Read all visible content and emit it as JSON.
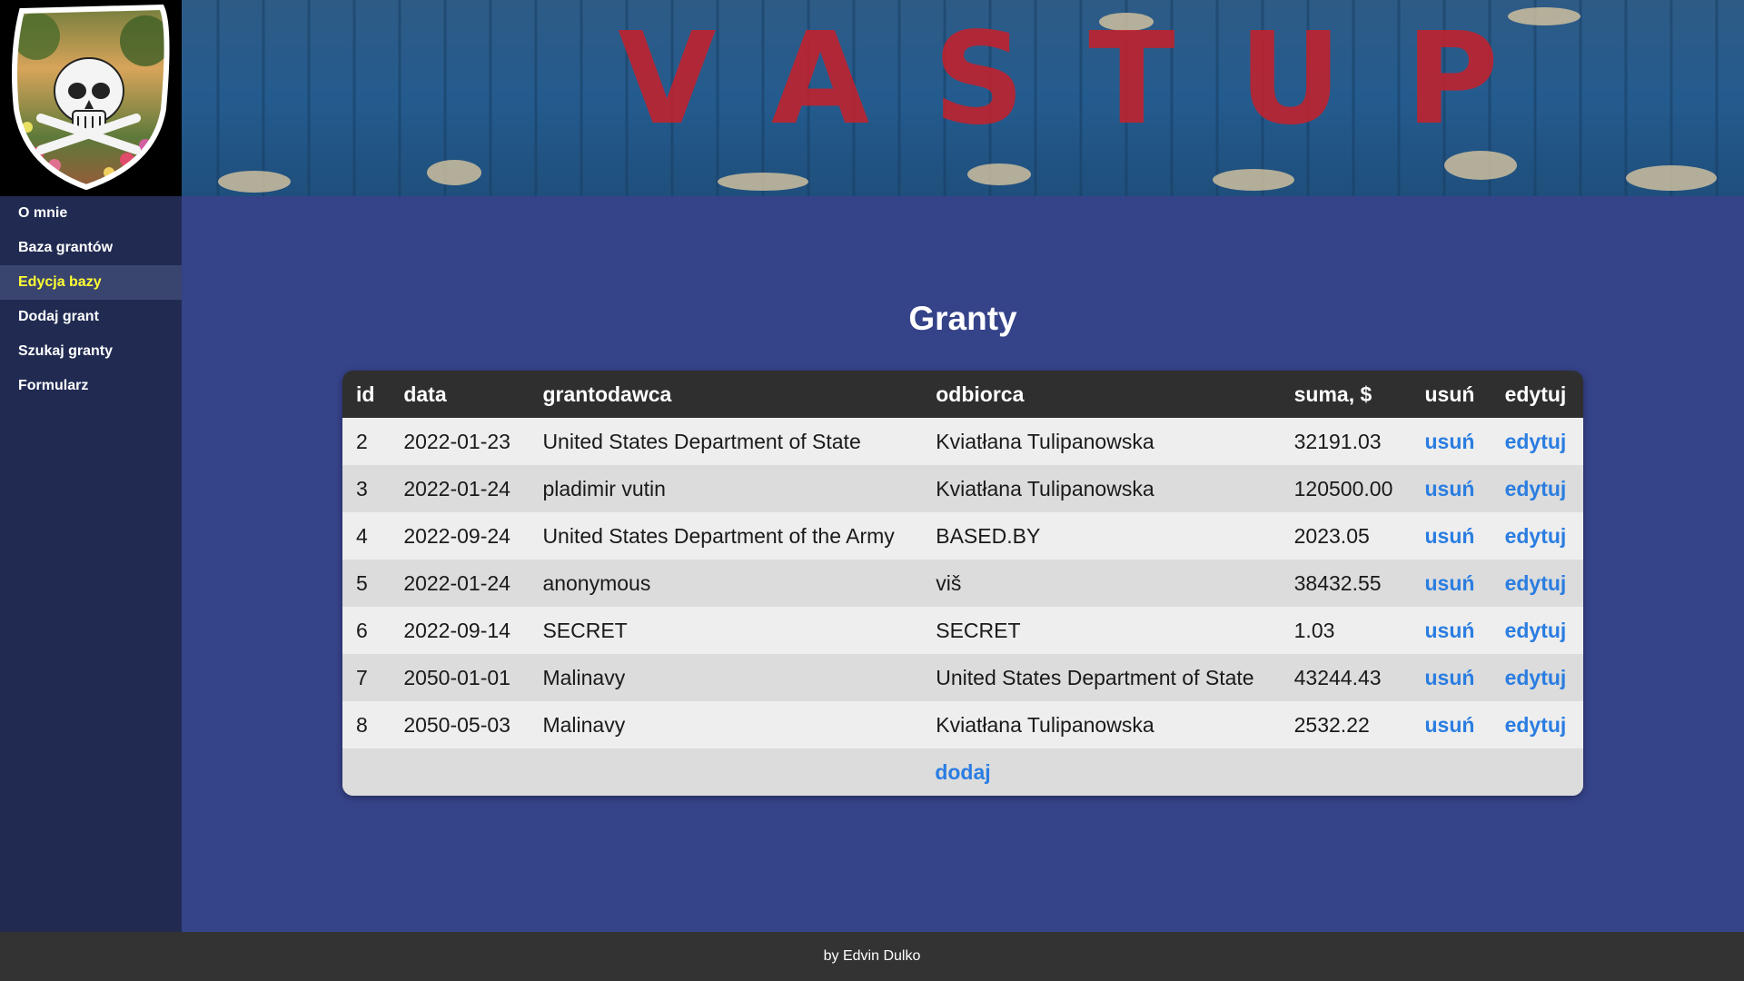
{
  "nav": {
    "items": [
      {
        "label": "O mnie"
      },
      {
        "label": "Baza grantów"
      },
      {
        "label": "Edycja bazy"
      },
      {
        "label": "Dodaj grant"
      },
      {
        "label": "Szukaj granty"
      },
      {
        "label": "Formularz"
      }
    ],
    "active_index": 2
  },
  "banner": {
    "graffiti_text": "VASTUP"
  },
  "main": {
    "title": "Granty",
    "table": {
      "headers": [
        "id",
        "data",
        "grantodawca",
        "odbiorca",
        "suma, $",
        "usuń",
        "edytuj"
      ],
      "rows": [
        {
          "id": "2",
          "data": "2022-01-23",
          "grantodawca": "United States Department of State",
          "odbiorca": "Kviatłana Tulipanowska",
          "suma": "32191.03",
          "delete": "usuń",
          "edit": "edytuj"
        },
        {
          "id": "3",
          "data": "2022-01-24",
          "grantodawca": "pladimir vutin",
          "odbiorca": "Kviatłana Tulipanowska",
          "suma": "120500.00",
          "delete": "usuń",
          "edit": "edytuj"
        },
        {
          "id": "4",
          "data": "2022-09-24",
          "grantodawca": "United States Department of the Army",
          "odbiorca": "BASED.BY",
          "suma": "2023.05",
          "delete": "usuń",
          "edit": "edytuj"
        },
        {
          "id": "5",
          "data": "2022-01-24",
          "grantodawca": "anonymous",
          "odbiorca": "viš",
          "suma": "38432.55",
          "delete": "usuń",
          "edit": "edytuj"
        },
        {
          "id": "6",
          "data": "2022-09-14",
          "grantodawca": "SECRET",
          "odbiorca": "SECRET",
          "suma": "1.03",
          "delete": "usuń",
          "edit": "edytuj"
        },
        {
          "id": "7",
          "data": "2050-01-01",
          "grantodawca": "Malinavy",
          "odbiorca": "United States Department of State",
          "suma": "43244.43",
          "delete": "usuń",
          "edit": "edytuj"
        },
        {
          "id": "8",
          "data": "2050-05-03",
          "grantodawca": "Malinavy",
          "odbiorca": "Kviatłana Tulipanowska",
          "suma": "2532.22",
          "delete": "usuń",
          "edit": "edytuj"
        }
      ],
      "add_label": "dodaj"
    }
  },
  "footer": {
    "text": "by Edvin Dulko"
  },
  "colors": {
    "page_bg": "#354389",
    "sidebar_bg": "#212b52",
    "active_nav_bg": "#3a456f",
    "active_nav_text": "#ffff33",
    "table_header_bg": "#2f2f2f",
    "link": "#2a7de1",
    "footer_bg": "#333333"
  }
}
